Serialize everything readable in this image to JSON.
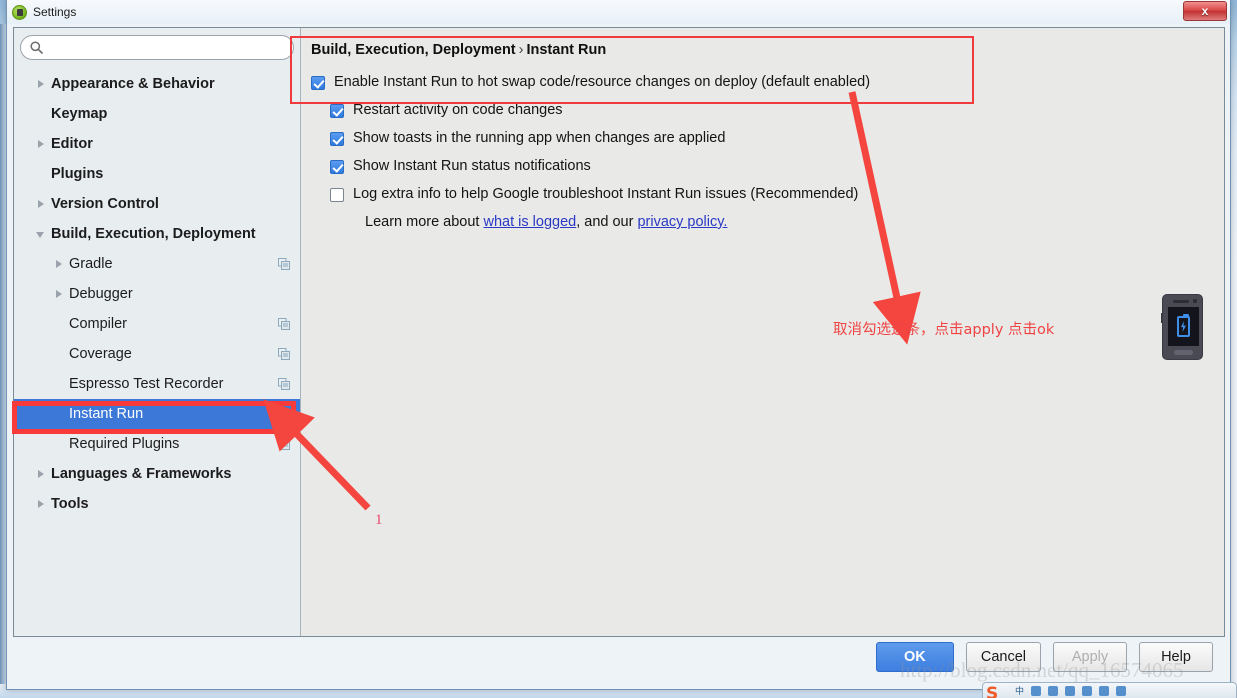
{
  "window": {
    "title": "Settings",
    "icon": "android-studio-icon",
    "close_label": "x"
  },
  "search": {
    "value": "",
    "placeholder": "",
    "icon": "search-icon"
  },
  "sidebar": {
    "items": [
      {
        "label": "Appearance & Behavior",
        "level": 0,
        "arrow": "right",
        "selected": false,
        "copy_icon": false
      },
      {
        "label": "Keymap",
        "level": 0,
        "arrow": "none",
        "selected": false,
        "copy_icon": false
      },
      {
        "label": "Editor",
        "level": 0,
        "arrow": "right",
        "selected": false,
        "copy_icon": false
      },
      {
        "label": "Plugins",
        "level": 0,
        "arrow": "none",
        "selected": false,
        "copy_icon": false
      },
      {
        "label": "Version Control",
        "level": 0,
        "arrow": "right",
        "selected": false,
        "copy_icon": false
      },
      {
        "label": "Build, Execution, Deployment",
        "level": 0,
        "arrow": "down",
        "selected": false,
        "copy_icon": false
      },
      {
        "label": "Gradle",
        "level": 1,
        "arrow": "right",
        "selected": false,
        "copy_icon": true
      },
      {
        "label": "Debugger",
        "level": 1,
        "arrow": "right",
        "selected": false,
        "copy_icon": false
      },
      {
        "label": "Compiler",
        "level": 1,
        "arrow": "none",
        "selected": false,
        "copy_icon": true
      },
      {
        "label": "Coverage",
        "level": 1,
        "arrow": "none",
        "selected": false,
        "copy_icon": true
      },
      {
        "label": "Espresso Test Recorder",
        "level": 1,
        "arrow": "none",
        "selected": false,
        "copy_icon": true
      },
      {
        "label": "Instant Run",
        "level": 1,
        "arrow": "none",
        "selected": true,
        "copy_icon": false
      },
      {
        "label": "Required Plugins",
        "level": 1,
        "arrow": "none",
        "selected": false,
        "copy_icon": true
      },
      {
        "label": "Languages & Frameworks",
        "level": 0,
        "arrow": "right",
        "selected": false,
        "copy_icon": false
      },
      {
        "label": "Tools",
        "level": 0,
        "arrow": "right",
        "selected": false,
        "copy_icon": false
      }
    ]
  },
  "main": {
    "breadcrumb_parent": "Build, Execution, Deployment",
    "breadcrumb_sep": "›",
    "breadcrumb_current": "Instant Run",
    "options": [
      {
        "label": "Enable Instant Run to hot swap code/resource changes on deploy (default enabled)",
        "checked": true,
        "indent": false
      },
      {
        "label": "Restart activity on code changes",
        "checked": true,
        "indent": true
      },
      {
        "label": "Show toasts in the running app when changes are applied",
        "checked": true,
        "indent": true
      },
      {
        "label": "Show Instant Run status notifications",
        "checked": true,
        "indent": true
      },
      {
        "label": "Log extra info to help Google troubleshoot Instant Run issues (Recommended)",
        "checked": false,
        "indent": true
      }
    ],
    "learn_more": {
      "prefix": "Learn more about ",
      "link1": "what is logged",
      "middle": ", and our ",
      "link2": "privacy policy.",
      "suffix": ""
    },
    "device_icon": "phone-charging-icon"
  },
  "annotations": {
    "chinese_note": "取消勾选这条，点击apply 点击ok",
    "step_number": "1",
    "highlight_color": "#f93a3a",
    "arrow_color": "#f5453f"
  },
  "footer": {
    "buttons": [
      {
        "label": "OK",
        "style": "primary"
      },
      {
        "label": "Cancel",
        "style": "normal"
      },
      {
        "label": "Apply",
        "style": "disabled"
      },
      {
        "label": "Help",
        "style": "normal"
      }
    ]
  },
  "overlay": {
    "watermark": "http://blog.csdn.net/qq_16574065",
    "ime_label": "中"
  }
}
